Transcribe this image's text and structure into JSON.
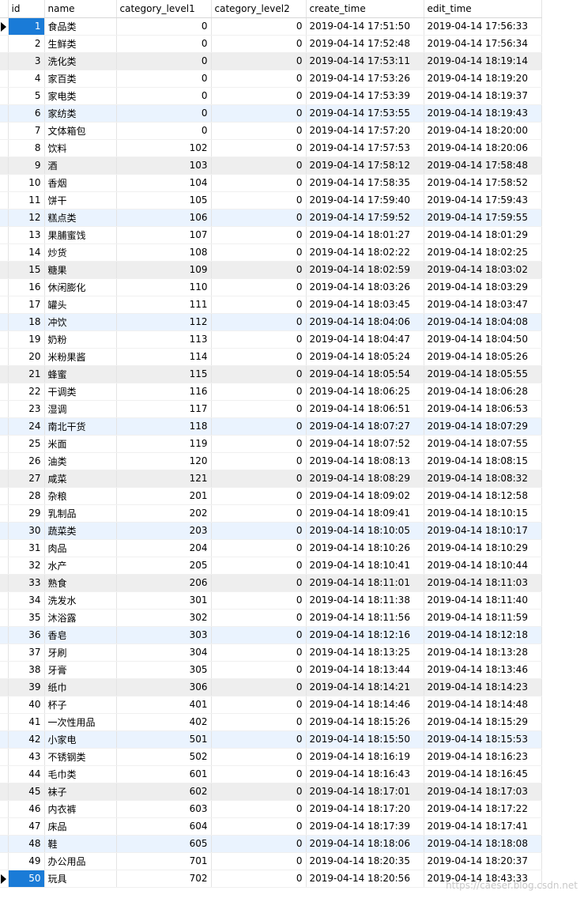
{
  "columns": [
    "id",
    "name",
    "category_level1",
    "category_level2",
    "create_time",
    "edit_time"
  ],
  "rows": [
    [
      "1",
      "食品类",
      "0",
      "0",
      "2019-04-14 17:51:50",
      "2019-04-14 17:56:33"
    ],
    [
      "2",
      "生鲜类",
      "0",
      "0",
      "2019-04-14 17:52:48",
      "2019-04-14 17:56:34"
    ],
    [
      "3",
      "洗化类",
      "0",
      "0",
      "2019-04-14 17:53:11",
      "2019-04-14 18:19:14"
    ],
    [
      "4",
      "家百类",
      "0",
      "0",
      "2019-04-14 17:53:26",
      "2019-04-14 18:19:20"
    ],
    [
      "5",
      "家电类",
      "0",
      "0",
      "2019-04-14 17:53:39",
      "2019-04-14 18:19:37"
    ],
    [
      "6",
      "家纺类",
      "0",
      "0",
      "2019-04-14 17:53:55",
      "2019-04-14 18:19:43"
    ],
    [
      "7",
      "文体箱包",
      "0",
      "0",
      "2019-04-14 17:57:20",
      "2019-04-14 18:20:00"
    ],
    [
      "8",
      "饮料",
      "102",
      "0",
      "2019-04-14 17:57:53",
      "2019-04-14 18:20:06"
    ],
    [
      "9",
      "酒",
      "103",
      "0",
      "2019-04-14 17:58:12",
      "2019-04-14 17:58:48"
    ],
    [
      "10",
      "香烟",
      "104",
      "0",
      "2019-04-14 17:58:35",
      "2019-04-14 17:58:52"
    ],
    [
      "11",
      "饼干",
      "105",
      "0",
      "2019-04-14 17:59:40",
      "2019-04-14 17:59:43"
    ],
    [
      "12",
      "糕点类",
      "106",
      "0",
      "2019-04-14 17:59:52",
      "2019-04-14 17:59:55"
    ],
    [
      "13",
      "果脯蜜饯",
      "107",
      "0",
      "2019-04-14 18:01:27",
      "2019-04-14 18:01:29"
    ],
    [
      "14",
      "炒货",
      "108",
      "0",
      "2019-04-14 18:02:22",
      "2019-04-14 18:02:25"
    ],
    [
      "15",
      "糖果",
      "109",
      "0",
      "2019-04-14 18:02:59",
      "2019-04-14 18:03:02"
    ],
    [
      "16",
      "休闲膨化",
      "110",
      "0",
      "2019-04-14 18:03:26",
      "2019-04-14 18:03:29"
    ],
    [
      "17",
      "罐头",
      "111",
      "0",
      "2019-04-14 18:03:45",
      "2019-04-14 18:03:47"
    ],
    [
      "18",
      "冲饮",
      "112",
      "0",
      "2019-04-14 18:04:06",
      "2019-04-14 18:04:08"
    ],
    [
      "19",
      "奶粉",
      "113",
      "0",
      "2019-04-14 18:04:47",
      "2019-04-14 18:04:50"
    ],
    [
      "20",
      "米粉果酱",
      "114",
      "0",
      "2019-04-14 18:05:24",
      "2019-04-14 18:05:26"
    ],
    [
      "21",
      "蜂蜜",
      "115",
      "0",
      "2019-04-14 18:05:54",
      "2019-04-14 18:05:55"
    ],
    [
      "22",
      "干调类",
      "116",
      "0",
      "2019-04-14 18:06:25",
      "2019-04-14 18:06:28"
    ],
    [
      "23",
      "湿调",
      "117",
      "0",
      "2019-04-14 18:06:51",
      "2019-04-14 18:06:53"
    ],
    [
      "24",
      "南北干货",
      "118",
      "0",
      "2019-04-14 18:07:27",
      "2019-04-14 18:07:29"
    ],
    [
      "25",
      "米面",
      "119",
      "0",
      "2019-04-14 18:07:52",
      "2019-04-14 18:07:55"
    ],
    [
      "26",
      "油类",
      "120",
      "0",
      "2019-04-14 18:08:13",
      "2019-04-14 18:08:15"
    ],
    [
      "27",
      "咸菜",
      "121",
      "0",
      "2019-04-14 18:08:29",
      "2019-04-14 18:08:32"
    ],
    [
      "28",
      "杂粮",
      "201",
      "0",
      "2019-04-14 18:09:02",
      "2019-04-14 18:12:58"
    ],
    [
      "29",
      "乳制品",
      "202",
      "0",
      "2019-04-14 18:09:41",
      "2019-04-14 18:10:15"
    ],
    [
      "30",
      "蔬菜类",
      "203",
      "0",
      "2019-04-14 18:10:05",
      "2019-04-14 18:10:17"
    ],
    [
      "31",
      "肉品",
      "204",
      "0",
      "2019-04-14 18:10:26",
      "2019-04-14 18:10:29"
    ],
    [
      "32",
      "水产",
      "205",
      "0",
      "2019-04-14 18:10:41",
      "2019-04-14 18:10:44"
    ],
    [
      "33",
      "熟食",
      "206",
      "0",
      "2019-04-14 18:11:01",
      "2019-04-14 18:11:03"
    ],
    [
      "34",
      "洗发水",
      "301",
      "0",
      "2019-04-14 18:11:38",
      "2019-04-14 18:11:40"
    ],
    [
      "35",
      "沐浴露",
      "302",
      "0",
      "2019-04-14 18:11:56",
      "2019-04-14 18:11:59"
    ],
    [
      "36",
      "香皂",
      "303",
      "0",
      "2019-04-14 18:12:16",
      "2019-04-14 18:12:18"
    ],
    [
      "37",
      "牙刷",
      "304",
      "0",
      "2019-04-14 18:13:25",
      "2019-04-14 18:13:28"
    ],
    [
      "38",
      "牙膏",
      "305",
      "0",
      "2019-04-14 18:13:44",
      "2019-04-14 18:13:46"
    ],
    [
      "39",
      "纸巾",
      "306",
      "0",
      "2019-04-14 18:14:21",
      "2019-04-14 18:14:23"
    ],
    [
      "40",
      "杯子",
      "401",
      "0",
      "2019-04-14 18:14:46",
      "2019-04-14 18:14:48"
    ],
    [
      "41",
      "一次性用品",
      "402",
      "0",
      "2019-04-14 18:15:26",
      "2019-04-14 18:15:29"
    ],
    [
      "42",
      "小家电",
      "501",
      "0",
      "2019-04-14 18:15:50",
      "2019-04-14 18:15:53"
    ],
    [
      "43",
      "不锈钢类",
      "502",
      "0",
      "2019-04-14 18:16:19",
      "2019-04-14 18:16:23"
    ],
    [
      "44",
      "毛巾类",
      "601",
      "0",
      "2019-04-14 18:16:43",
      "2019-04-14 18:16:45"
    ],
    [
      "45",
      "袜子",
      "602",
      "0",
      "2019-04-14 18:17:01",
      "2019-04-14 18:17:03"
    ],
    [
      "46",
      "内衣裤",
      "603",
      "0",
      "2019-04-14 18:17:20",
      "2019-04-14 18:17:22"
    ],
    [
      "47",
      "床品",
      "604",
      "0",
      "2019-04-14 18:17:39",
      "2019-04-14 18:17:41"
    ],
    [
      "48",
      "鞋",
      "605",
      "0",
      "2019-04-14 18:18:06",
      "2019-04-14 18:18:08"
    ],
    [
      "49",
      "办公用品",
      "701",
      "0",
      "2019-04-14 18:20:35",
      "2019-04-14 18:20:37"
    ],
    [
      "50",
      "玩具",
      "702",
      "0",
      "2019-04-14 18:20:56",
      "2019-04-14 18:43:33"
    ]
  ],
  "watermark": "https://caeser.blog.csdn.net"
}
